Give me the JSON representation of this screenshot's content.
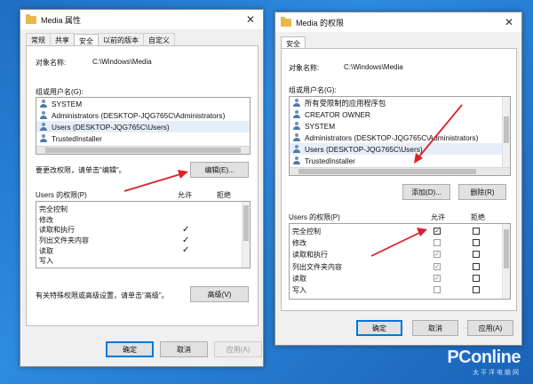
{
  "left": {
    "title": "Media 属性",
    "tabs": [
      "常规",
      "共享",
      "安全",
      "以前的版本",
      "自定义"
    ],
    "object_label": "对象名称:",
    "object_value": "C:\\Windows\\Media",
    "group_label": "组或用户名(G):",
    "users": [
      "SYSTEM",
      "Administrators (DESKTOP-JQG765C\\Administrators)",
      "Users (DESKTOP-JQG765C\\Users)",
      "TrustedInstaller"
    ],
    "change_hint": "要更改权限，请单击\"编辑\"。",
    "edit_button": "编辑(E)...",
    "perm_label": "Users 的权限(P)",
    "allow_label": "允许",
    "deny_label": "拒绝",
    "permissions": [
      "完全控制",
      "修改",
      "读取和执行",
      "列出文件夹内容",
      "读取",
      "写入"
    ],
    "allow_checks": [
      false,
      false,
      true,
      true,
      true,
      false
    ],
    "advanced_hint": "有关特殊权限或高级设置，请单击\"高级\"。",
    "advanced_button": "高级(V)",
    "ok": "确定",
    "cancel": "取消",
    "apply": "应用(A)"
  },
  "right": {
    "title": "Media 的权限",
    "tab": "安全",
    "object_label": "对象名称:",
    "object_value": "C:\\Windows\\Media",
    "group_label": "组或用户名(G):",
    "users": [
      "所有受限制的应用程序包",
      "CREATOR OWNER",
      "SYSTEM",
      "Administrators (DESKTOP-JQG765C\\Administrators)",
      "Users (DESKTOP-JQG765C\\Users)",
      "TrustedInstaller"
    ],
    "add_button": "添加(D)...",
    "remove_button": "删除(R)",
    "perm_label": "Users 的权限(P)",
    "allow_label": "允许",
    "deny_label": "拒绝",
    "permissions": [
      "完全控制",
      "修改",
      "读取和执行",
      "列出文件夹内容",
      "读取",
      "写入"
    ],
    "allow_checks": [
      true,
      false,
      true,
      true,
      true,
      false
    ],
    "ok": "确定",
    "cancel": "取消",
    "apply": "应用(A)"
  },
  "watermark": {
    "brand": "PConline",
    "sub": "太平洋电脑网"
  },
  "colors": {
    "desktop": "#1f6fc4",
    "arrow": "#d9222a",
    "accent": "#0078d7"
  }
}
